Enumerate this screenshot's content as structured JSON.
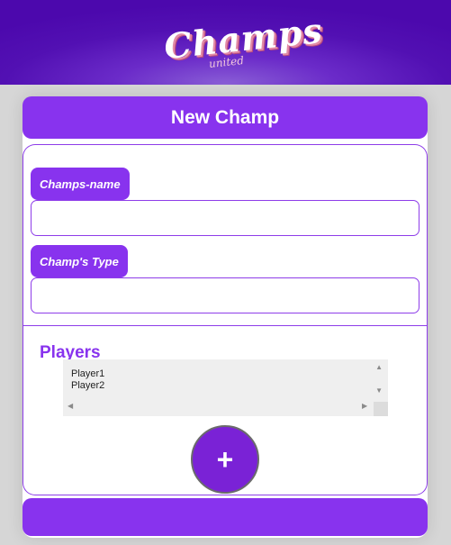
{
  "header": {
    "logo_text": "Champs",
    "logo_subtext": "united"
  },
  "form": {
    "title": "New Champ",
    "name_label": "Champs-name",
    "name_value": "",
    "type_label": "Champ's Type",
    "type_value": ""
  },
  "players": {
    "title": "Players",
    "items": [
      "Player1",
      "Player2"
    ]
  },
  "actions": {
    "add_label": "+"
  },
  "colors": {
    "accent": "#8833ee",
    "header": "#5210b3"
  }
}
